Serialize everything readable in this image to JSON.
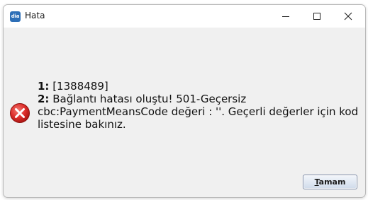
{
  "window": {
    "title": "Hata",
    "app_icon_text": "dia"
  },
  "icons": {
    "app": "dia-app-icon",
    "minimize": "minimize-icon",
    "maximize": "maximize-icon",
    "close": "close-icon",
    "error": "error-icon"
  },
  "message": {
    "line1_number": "1:",
    "line1_text": " [1388489]",
    "line2_number": "2:",
    "line2_text": " Bağlantı hatası oluştu! 501-Geçersiz cbc:PaymentMeansCode değeri : ''. Geçerli değerler için kod listesine bakınız."
  },
  "buttons": {
    "ok_mnemonic": "T",
    "ok_rest": "amam"
  },
  "colors": {
    "error_red": "#d9262b",
    "app_icon_blue": "#2d6fb7",
    "dialog_background": "#f0f0f0"
  }
}
